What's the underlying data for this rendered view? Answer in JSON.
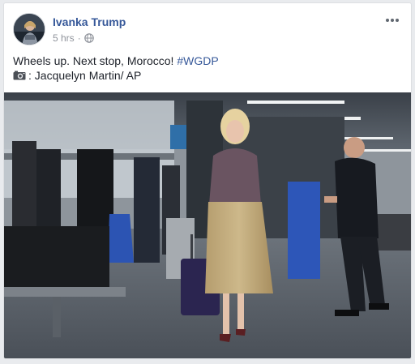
{
  "post": {
    "author_name": "Ivanka Trump",
    "timestamp": "5 hrs",
    "separator": "·",
    "privacy_icon": "globe-icon",
    "more_icon": "ellipsis-icon",
    "text_main": "Wheels up. Next stop, Morocco! ",
    "hashtag": "#WGDP",
    "camera_icon": "camera-icon",
    "credit": ": Jacquelyn Martin/ AP"
  },
  "colors": {
    "link": "#365899",
    "muted": "#90949c",
    "text": "#1d2129",
    "page_bg": "#e9ebee"
  }
}
